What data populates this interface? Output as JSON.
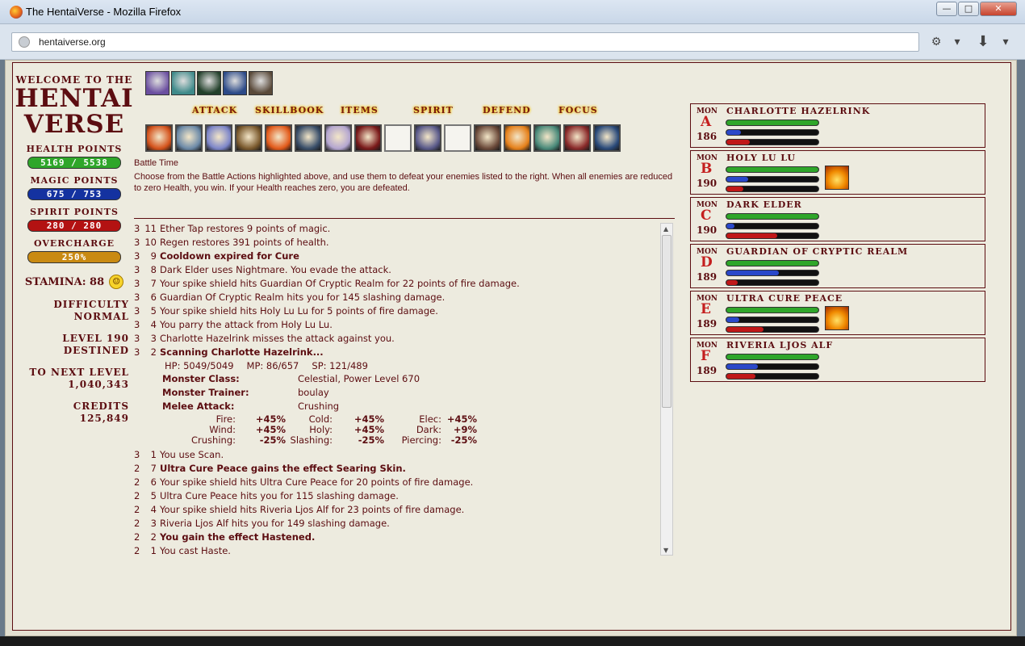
{
  "window": {
    "title": "The HentaiVerse - Mozilla Firefox",
    "url": "hentaiverse.org"
  },
  "status": {
    "welcome": "WELCOME TO THE",
    "brand_line1": "HENTAI",
    "brand_line2": "VERSE",
    "health_label": "HEALTH POINTS",
    "health_value": "5169 / 5538",
    "magic_label": "MAGIC POINTS",
    "magic_value": "675 / 753",
    "spirit_label": "SPIRIT POINTS",
    "spirit_value": "280 / 280",
    "overcharge_label": "OVERCHARGE",
    "overcharge_value": "250%",
    "stamina": "STAMINA: 88",
    "difficulty_label": "DIFFICULTY",
    "difficulty_value": "NORMAL",
    "level_label": "LEVEL 190",
    "level_value": "DESTINED",
    "next_level_label": "TO NEXT LEVEL",
    "next_level_value": "1,040,343",
    "credits_label": "CREDITS",
    "credits_value": "125,849"
  },
  "menu": {
    "attack": "ATTACK",
    "skillbook": "SKILLBOOK",
    "items": "ITEMS",
    "spirit": "SPIRIT",
    "defend": "DEFEND",
    "focus": "FOCUS"
  },
  "effect_colors": [
    "#6b4fa0",
    "#3f8a8a",
    "#23402b",
    "#2c4a88",
    "#5a4a3a"
  ],
  "skill_slots": [
    {
      "color": "#d4521b"
    },
    {
      "color": "#6c8aa8"
    },
    {
      "color": "#7d86c9"
    },
    {
      "color": "#7b5a2e"
    },
    {
      "color": "#e25a1a"
    },
    {
      "color": "#3a4f6a"
    },
    {
      "color": "#b4a6d0"
    },
    {
      "color": "#7a1a1a"
    },
    {
      "color": ""
    },
    {
      "color": "#5a5a8a"
    },
    {
      "color": ""
    },
    {
      "color": "#6b4a3a"
    },
    {
      "color": "#e5801a"
    },
    {
      "color": "#4a8a7a"
    },
    {
      "color": "#8a2a2a"
    },
    {
      "color": "#2a4a7a"
    }
  ],
  "battle": {
    "title": "Battle Time",
    "description": "Choose from the Battle Actions highlighted above, and use them to defeat your enemies listed to the right. When all enemies are reduced to zero Health, you win. If your Health reaches zero, you are defeated."
  },
  "log": {
    "top": [
      {
        "t": "3",
        "n": "11",
        "m": "Ether Tap restores 9 points of magic.",
        "bold": false
      },
      {
        "t": "3",
        "n": "10",
        "m": "Regen restores 391 points of health.",
        "bold": false
      },
      {
        "t": "3",
        "n": "9",
        "m": "Cooldown expired for Cure",
        "bold": true
      },
      {
        "t": "3",
        "n": "8",
        "m": "Dark Elder uses Nightmare. You evade the attack.",
        "bold": false
      },
      {
        "t": "3",
        "n": "7",
        "m": "Your spike shield hits Guardian Of Cryptic Realm for 22 points of fire damage.",
        "bold": false
      },
      {
        "t": "3",
        "n": "6",
        "m": "Guardian Of Cryptic Realm hits you for 145 slashing damage.",
        "bold": false
      },
      {
        "t": "3",
        "n": "5",
        "m": "Your spike shield hits Holy Lu Lu for 5 points of fire damage.",
        "bold": false
      },
      {
        "t": "3",
        "n": "4",
        "m": "You parry the attack from Holy Lu Lu.",
        "bold": false
      },
      {
        "t": "3",
        "n": "3",
        "m": "Charlotte Hazelrink misses the attack against you.",
        "bold": false
      },
      {
        "t": "3",
        "n": "2",
        "m": "Scanning Charlotte Hazelrink...",
        "bold": true
      }
    ],
    "scan": {
      "hp": "HP: 5049/5049",
      "mp": "MP: 86/657",
      "sp": "SP: 121/489",
      "rows": [
        {
          "k": "Monster Class:",
          "v": "Celestial, Power Level 670"
        },
        {
          "k": "Monster Trainer:",
          "v": "boulay"
        },
        {
          "k": "Melee Attack:",
          "v": "Crushing"
        }
      ],
      "resists": [
        [
          "Fire:",
          "+45%",
          "Cold:",
          "+45%",
          "Elec:",
          "+45%"
        ],
        [
          "Wind:",
          "+45%",
          "Holy:",
          "+45%",
          "Dark:",
          "+9%"
        ],
        [
          "Crushing:",
          "-25%",
          "Slashing:",
          "-25%",
          "Piercing:",
          "-25%"
        ]
      ]
    },
    "bottom": [
      {
        "t": "3",
        "n": "1",
        "m": "You use Scan.",
        "bold": false
      },
      {
        "t": "2",
        "n": "7",
        "m": "Ultra Cure Peace gains the effect Searing Skin.",
        "bold": true
      },
      {
        "t": "2",
        "n": "6",
        "m": "Your spike shield hits Ultra Cure Peace for 20 points of fire damage.",
        "bold": false
      },
      {
        "t": "2",
        "n": "5",
        "m": "Ultra Cure Peace hits you for 115 slashing damage.",
        "bold": false
      },
      {
        "t": "2",
        "n": "4",
        "m": "Your spike shield hits Riveria Ljos Alf for 23 points of fire damage.",
        "bold": false
      },
      {
        "t": "2",
        "n": "3",
        "m": "Riveria Ljos Alf hits you for 149 slashing damage.",
        "bold": false
      },
      {
        "t": "2",
        "n": "2",
        "m": "You gain the effect Hastened.",
        "bold": true
      },
      {
        "t": "2",
        "n": "1",
        "m": "You cast Haste.",
        "bold": false
      }
    ]
  },
  "monsters": [
    {
      "tag": "MON",
      "letter": "A",
      "level": "186",
      "name": "CHARLOTTE HAZELRINK",
      "hp": 1.0,
      "mp": 0.16,
      "sp": 0.25,
      "buff": false
    },
    {
      "tag": "MON",
      "letter": "B",
      "level": "190",
      "name": "HOLY LU LU",
      "hp": 1.0,
      "mp": 0.24,
      "sp": 0.18,
      "buff": true
    },
    {
      "tag": "MON",
      "letter": "C",
      "level": "190",
      "name": "DARK ELDER",
      "hp": 1.0,
      "mp": 0.09,
      "sp": 0.55,
      "buff": false
    },
    {
      "tag": "MON",
      "letter": "D",
      "level": "189",
      "name": "GUARDIAN OF CRYPTIC REALM",
      "hp": 1.0,
      "mp": 0.57,
      "sp": 0.12,
      "buff": false
    },
    {
      "tag": "MON",
      "letter": "E",
      "level": "189",
      "name": "ULTRA CURE PEACE",
      "hp": 1.0,
      "mp": 0.14,
      "sp": 0.4,
      "buff": true
    },
    {
      "tag": "MON",
      "letter": "F",
      "level": "189",
      "name": "RIVERIA LJOS ALF",
      "hp": 1.0,
      "mp": 0.34,
      "sp": 0.32,
      "buff": false
    }
  ]
}
